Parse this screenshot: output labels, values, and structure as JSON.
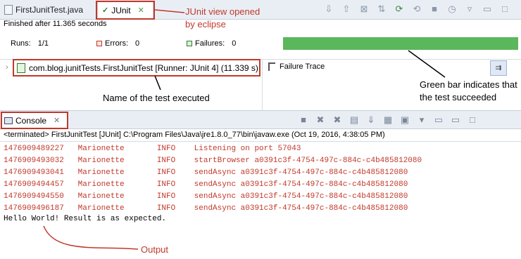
{
  "tabs": {
    "file_tab": "FirstJunitTest.java",
    "junit_tab": "JUnit",
    "console_tab": "Console"
  },
  "junit": {
    "finished_text": "Finished after 11.365 seconds",
    "runs_label": "Runs:",
    "runs_value": "1/1",
    "errors_label": "Errors:",
    "errors_value": "0",
    "failures_label": "Failures:",
    "failures_value": "0",
    "progress_fraction": 1.0,
    "progress_color": "#5bb75b",
    "test_item": "com.blog.junitTests.FirstJunitTest [Runner: JUnit 4] (11.339 s)",
    "failure_trace_label": "Failure Trace"
  },
  "annotations": {
    "junit_view": "JUnit view opened",
    "junit_view_2": "by eclipse",
    "test_name": "Name of the test executed",
    "green_bar_1": "Green bar indicates that",
    "green_bar_2": "the test succeeded",
    "output": "Output"
  },
  "console": {
    "terminated_line": "<terminated> FirstJunitTest [JUnit] C:\\Program Files\\Java\\jre1.8.0_77\\bin\\javaw.exe (Oct 19, 2016, 4:38:05 PM)",
    "log_lines": [
      "1476909489227   Marionette       INFO    Listening on port 57043",
      "1476909493032   Marionette       INFO    startBrowser a0391c3f-4754-497c-884c-c4b485812080",
      "1476909493041   Marionette       INFO    sendAsync a0391c3f-4754-497c-884c-c4b485812080",
      "1476909494457   Marionette       INFO    sendAsync a0391c3f-4754-497c-884c-c4b485812080",
      "1476909494550   Marionette       INFO    sendAsync a0391c3f-4754-497c-884c-c4b485812080",
      "1476909496187   Marionette       INFO    sendAsync a0391c3f-4754-497c-884c-c4b485812080"
    ],
    "output_line": "Hello World! Result is as expected."
  },
  "colors": {
    "annotation_red": "#c0392b",
    "log_red": "#c0392b",
    "success_green": "#5bb75b"
  }
}
